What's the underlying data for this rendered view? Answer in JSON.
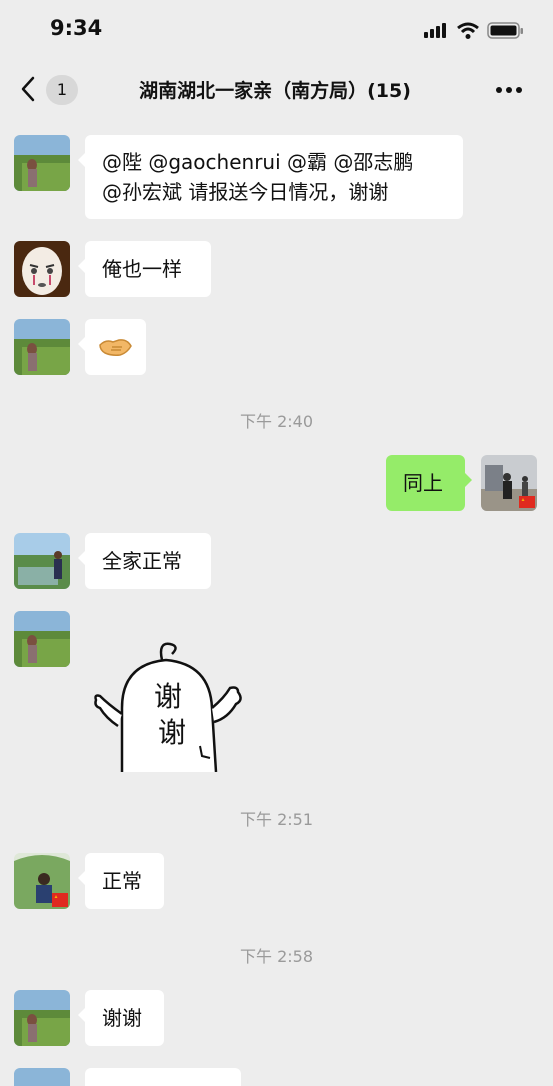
{
  "status_bar": {
    "time": "9:34"
  },
  "nav": {
    "unread_count": "1",
    "title": "湖南湖北一家亲（南方局）(15)"
  },
  "messages": [
    {
      "side": "left",
      "lines": [
        "@陛 @gaochenrui @霸 @邵志鹏",
        "@孙宏斌 请报送今日情况，谢谢"
      ]
    },
    {
      "side": "left",
      "text": "俺也一样"
    },
    {
      "side": "left",
      "emoji": "handshake"
    },
    {
      "timestamp": "下午 2:40"
    },
    {
      "side": "right",
      "text": "同上"
    },
    {
      "side": "left",
      "text": "全家正常"
    },
    {
      "side": "left",
      "sticker": "thanks-sticker",
      "sticker_text": [
        "谢",
        "谢"
      ]
    },
    {
      "timestamp": "下午 2:51"
    },
    {
      "side": "left",
      "text": "正常"
    },
    {
      "timestamp": "下午 2:58"
    },
    {
      "side": "left",
      "text": "谢谢"
    }
  ],
  "colors": {
    "background": "#ededed",
    "own_bubble": "#95ec69",
    "other_bubble": "#ffffff",
    "timestamp": "#9a9a9a"
  }
}
